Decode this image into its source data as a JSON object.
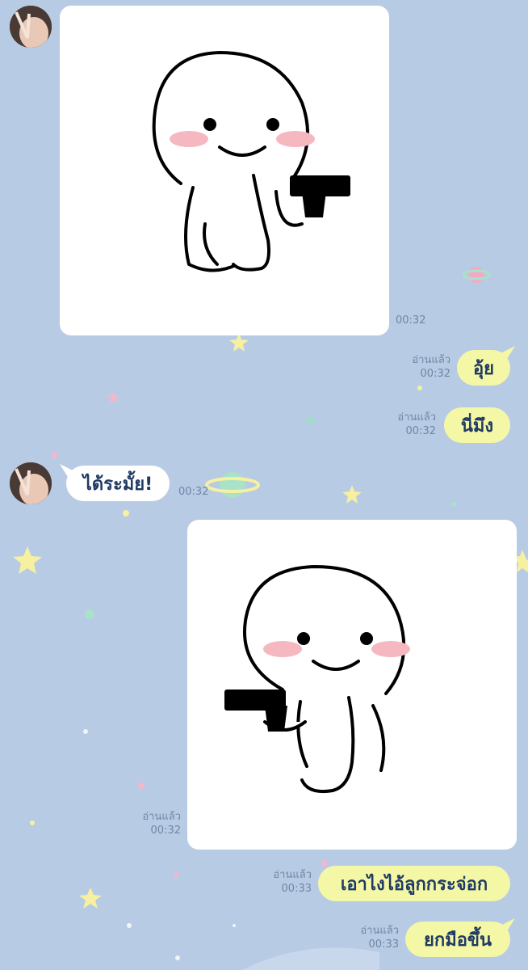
{
  "chat": {
    "messages": [
      {
        "type": "sticker",
        "side": "incoming",
        "time": "00:32",
        "sticker_icon": "gun-sticker-icon"
      },
      {
        "type": "text",
        "side": "outgoing",
        "text": "อุ้ย",
        "read_label": "อ่านแล้ว",
        "time": "00:32"
      },
      {
        "type": "text",
        "side": "outgoing",
        "text": "นี่มึง",
        "read_label": "อ่านแล้ว",
        "time": "00:32"
      },
      {
        "type": "text",
        "side": "incoming",
        "text": "ได้ระมั้ย!",
        "time": "00:32"
      },
      {
        "type": "sticker",
        "side": "outgoing",
        "read_label": "อ่านแล้ว",
        "time": "00:32",
        "sticker_icon": "gun-sticker-icon"
      },
      {
        "type": "text",
        "side": "outgoing",
        "text": "เอาไงไอ้ลูกกระจ่อก",
        "read_label": "อ่านแล้ว",
        "time": "00:33"
      },
      {
        "type": "text",
        "side": "outgoing",
        "text": "ยกมือขึ้น",
        "read_label": "อ่านแล้ว",
        "time": "00:33"
      }
    ]
  },
  "colors": {
    "background": "#b8cbe4",
    "outgoing_bubble": "#f3f7a6",
    "incoming_bubble": "#ffffff",
    "bubble_text": "#1f3a63",
    "meta_text": "#6f86a8"
  }
}
